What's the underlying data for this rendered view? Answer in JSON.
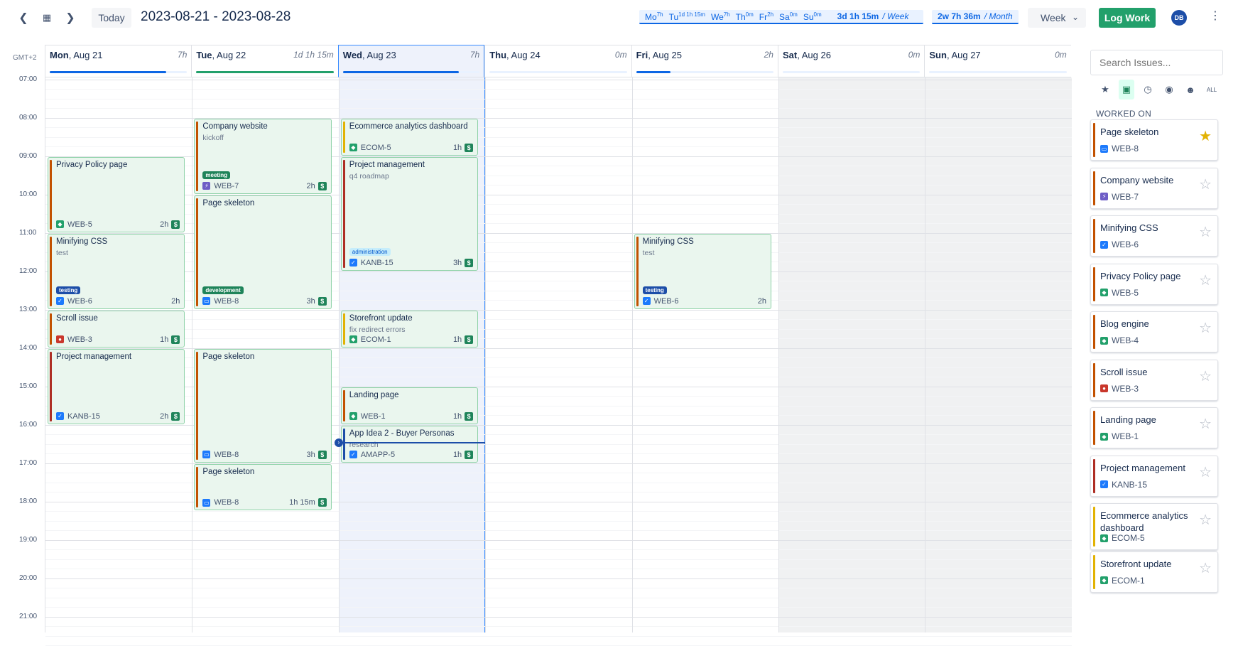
{
  "toolbar": {
    "prev_icon": "chevron-left-icon",
    "calendar_icon": "calendar-icon",
    "next_icon": "chevron-right-icon",
    "today_label": "Today",
    "date_range": "2023-08-21 - 2023-08-28",
    "week_summary": {
      "days": [
        {
          "label": "Mo",
          "value": "7h"
        },
        {
          "label": "Tu",
          "value": "1d 1h 15m"
        },
        {
          "label": "We",
          "value": "7h"
        },
        {
          "label": "Th",
          "value": "0m"
        },
        {
          "label": "Fr",
          "value": "2h"
        },
        {
          "label": "Sa",
          "value": "0m"
        },
        {
          "label": "Su",
          "value": "0m"
        }
      ],
      "total": "3d 1h 15m",
      "unit": "/ Week"
    },
    "month_summary": {
      "total": "2w 7h 36m",
      "unit": "/ Month"
    },
    "view_select": "Week",
    "log_work_label": "Log Work",
    "avatar_initials": "DB"
  },
  "calendar": {
    "timezone_label": "GMT+2",
    "hours": [
      "07:00",
      "08:00",
      "09:00",
      "10:00",
      "11:00",
      "12:00",
      "13:00",
      "14:00",
      "15:00",
      "16:00",
      "17:00",
      "18:00",
      "19:00",
      "20:00",
      "21:00"
    ],
    "days": [
      {
        "weekday": "Mon",
        "date": "Aug 21",
        "total": "7h",
        "progress": 0.85,
        "color": "#0c66e4"
      },
      {
        "weekday": "Tue",
        "date": "Aug 22",
        "total": "1d 1h 15m",
        "progress": 1.0,
        "color": "#22a06b"
      },
      {
        "weekday": "Wed",
        "date": "Aug 23",
        "total": "7h",
        "progress": 0.85,
        "color": "#0c66e4"
      },
      {
        "weekday": "Thu",
        "date": "Aug 24",
        "total": "0m",
        "progress": 0,
        "color": "#0c66e4"
      },
      {
        "weekday": "Fri",
        "date": "Aug 25",
        "total": "2h",
        "progress": 0.25,
        "color": "#0c66e4"
      },
      {
        "weekday": "Sat",
        "date": "Aug 26",
        "total": "0m",
        "progress": 0,
        "color": "#0c66e4"
      },
      {
        "weekday": "Sun",
        "date": "Aug 27",
        "total": "0m",
        "progress": 0,
        "color": "#0c66e4"
      }
    ],
    "events": [
      {
        "day": 0,
        "start": 9,
        "end": 11,
        "title": "Privacy Policy page",
        "desc": "",
        "tag": "",
        "key": "WEB-5",
        "type": "story",
        "duration": "2h",
        "billable": true,
        "strip": "#c25100"
      },
      {
        "day": 0,
        "start": 11,
        "end": 13,
        "title": "Minifying CSS",
        "desc": "test",
        "tag": "testing",
        "tag_color": "#1d4ea8",
        "key": "WEB-6",
        "type": "task",
        "duration": "2h",
        "billable": false,
        "strip": "#c25100"
      },
      {
        "day": 0,
        "start": 13,
        "end": 14,
        "title": "Scroll issue",
        "desc": "",
        "tag": "",
        "key": "WEB-3",
        "type": "bug",
        "duration": "1h",
        "billable": true,
        "strip": "#c25100"
      },
      {
        "day": 0,
        "start": 14,
        "end": 16,
        "title": "Project management",
        "desc": "",
        "tag": "",
        "key": "KANB-15",
        "type": "task",
        "duration": "2h",
        "billable": true,
        "strip": "#ae2e24"
      },
      {
        "day": 1,
        "start": 8,
        "end": 10,
        "title": "Company website",
        "desc": "kickoff",
        "tag": "meeting",
        "tag_color": "#1f845a",
        "key": "WEB-7",
        "type": "epic",
        "duration": "2h",
        "billable": true,
        "strip": "#c25100"
      },
      {
        "day": 1,
        "start": 10,
        "end": 13,
        "title": "Page skeleton",
        "desc": "",
        "tag": "development",
        "tag_color": "#1f845a",
        "key": "WEB-8",
        "type": "subtask",
        "duration": "3h",
        "billable": true,
        "strip": "#c25100"
      },
      {
        "day": 1,
        "start": 14,
        "end": 17,
        "title": "Page skeleton",
        "desc": "",
        "tag": "",
        "key": "WEB-8",
        "type": "subtask",
        "duration": "3h",
        "billable": true,
        "strip": "#c25100"
      },
      {
        "day": 1,
        "start": 17,
        "end": 18.25,
        "title": "Page skeleton",
        "desc": "",
        "tag": "",
        "key": "WEB-8",
        "type": "subtask",
        "duration": "1h 15m",
        "billable": true,
        "strip": "#c25100"
      },
      {
        "day": 2,
        "start": 8,
        "end": 9,
        "title": "Ecommerce analytics dashboard",
        "desc": "",
        "tag": "",
        "key": "ECOM-5",
        "type": "story",
        "duration": "1h",
        "billable": true,
        "strip": "#e2b203"
      },
      {
        "day": 2,
        "start": 9,
        "end": 12,
        "title": "Project management",
        "desc": "q4 roadmap",
        "tag": "administration",
        "tag_color": "#c6edfb",
        "tag_text": "#0055cc",
        "key": "KANB-15",
        "type": "task",
        "duration": "3h",
        "billable": true,
        "strip": "#ae2e24"
      },
      {
        "day": 2,
        "start": 13,
        "end": 14,
        "title": "Storefront update",
        "desc": "fix redirect errors",
        "tag": "",
        "key": "ECOM-1",
        "type": "story",
        "duration": "1h",
        "billable": true,
        "strip": "#e2b203"
      },
      {
        "day": 2,
        "start": 15,
        "end": 16,
        "title": "Landing page",
        "desc": "",
        "tag": "",
        "key": "WEB-1",
        "type": "story",
        "duration": "1h",
        "billable": true,
        "strip": "#c25100"
      },
      {
        "day": 2,
        "start": 16,
        "end": 17,
        "title": "App Idea 2 - Buyer Personas",
        "desc": "research",
        "tag": "",
        "key": "AMAPP-5",
        "type": "task",
        "duration": "1h",
        "billable": true,
        "strip": "#1d4ea8"
      },
      {
        "day": 4,
        "start": 11,
        "end": 13,
        "title": "Minifying CSS",
        "desc": "test",
        "tag": "testing",
        "tag_color": "#1d4ea8",
        "key": "WEB-6",
        "type": "task",
        "duration": "2h",
        "billable": false,
        "strip": "#c25100"
      }
    ],
    "now_hour": 16.45
  },
  "sidebar": {
    "search_placeholder": "Search Issues...",
    "filters": [
      {
        "icon": "star-icon",
        "glyph": "★",
        "active": false
      },
      {
        "icon": "briefcase-icon",
        "glyph": "▣",
        "active": true
      },
      {
        "icon": "clock-icon",
        "glyph": "◷",
        "active": false
      },
      {
        "icon": "eye-icon",
        "glyph": "◉",
        "active": false
      },
      {
        "icon": "user-icon",
        "glyph": "☻",
        "active": false
      },
      {
        "icon": "all-icon",
        "glyph": "ALL",
        "active": false
      }
    ],
    "section_title": "WORKED ON",
    "issues": [
      {
        "title": "Page skeleton",
        "key": "WEB-8",
        "type": "subtask",
        "starred": true,
        "strip": "#c25100"
      },
      {
        "title": "Company website",
        "key": "WEB-7",
        "type": "epic",
        "starred": false,
        "strip": "#c25100"
      },
      {
        "title": "Minifying CSS",
        "key": "WEB-6",
        "type": "task",
        "starred": false,
        "strip": "#c25100"
      },
      {
        "title": "Privacy Policy page",
        "key": "WEB-5",
        "type": "story",
        "starred": false,
        "strip": "#c25100"
      },
      {
        "title": "Blog engine",
        "key": "WEB-4",
        "type": "story",
        "starred": false,
        "strip": "#c25100"
      },
      {
        "title": "Scroll issue",
        "key": "WEB-3",
        "type": "bug",
        "starred": false,
        "strip": "#c25100"
      },
      {
        "title": "Landing page",
        "key": "WEB-1",
        "type": "story",
        "starred": false,
        "strip": "#c25100"
      },
      {
        "title": "Project management",
        "key": "KANB-15",
        "type": "task",
        "starred": false,
        "strip": "#ae2e24"
      },
      {
        "title": "Ecommerce analytics dashboard",
        "key": "ECOM-5",
        "type": "story",
        "starred": false,
        "strip": "#e2b203"
      },
      {
        "title": "Storefront update",
        "key": "ECOM-1",
        "type": "story",
        "starred": false,
        "strip": "#e2b203"
      }
    ]
  }
}
